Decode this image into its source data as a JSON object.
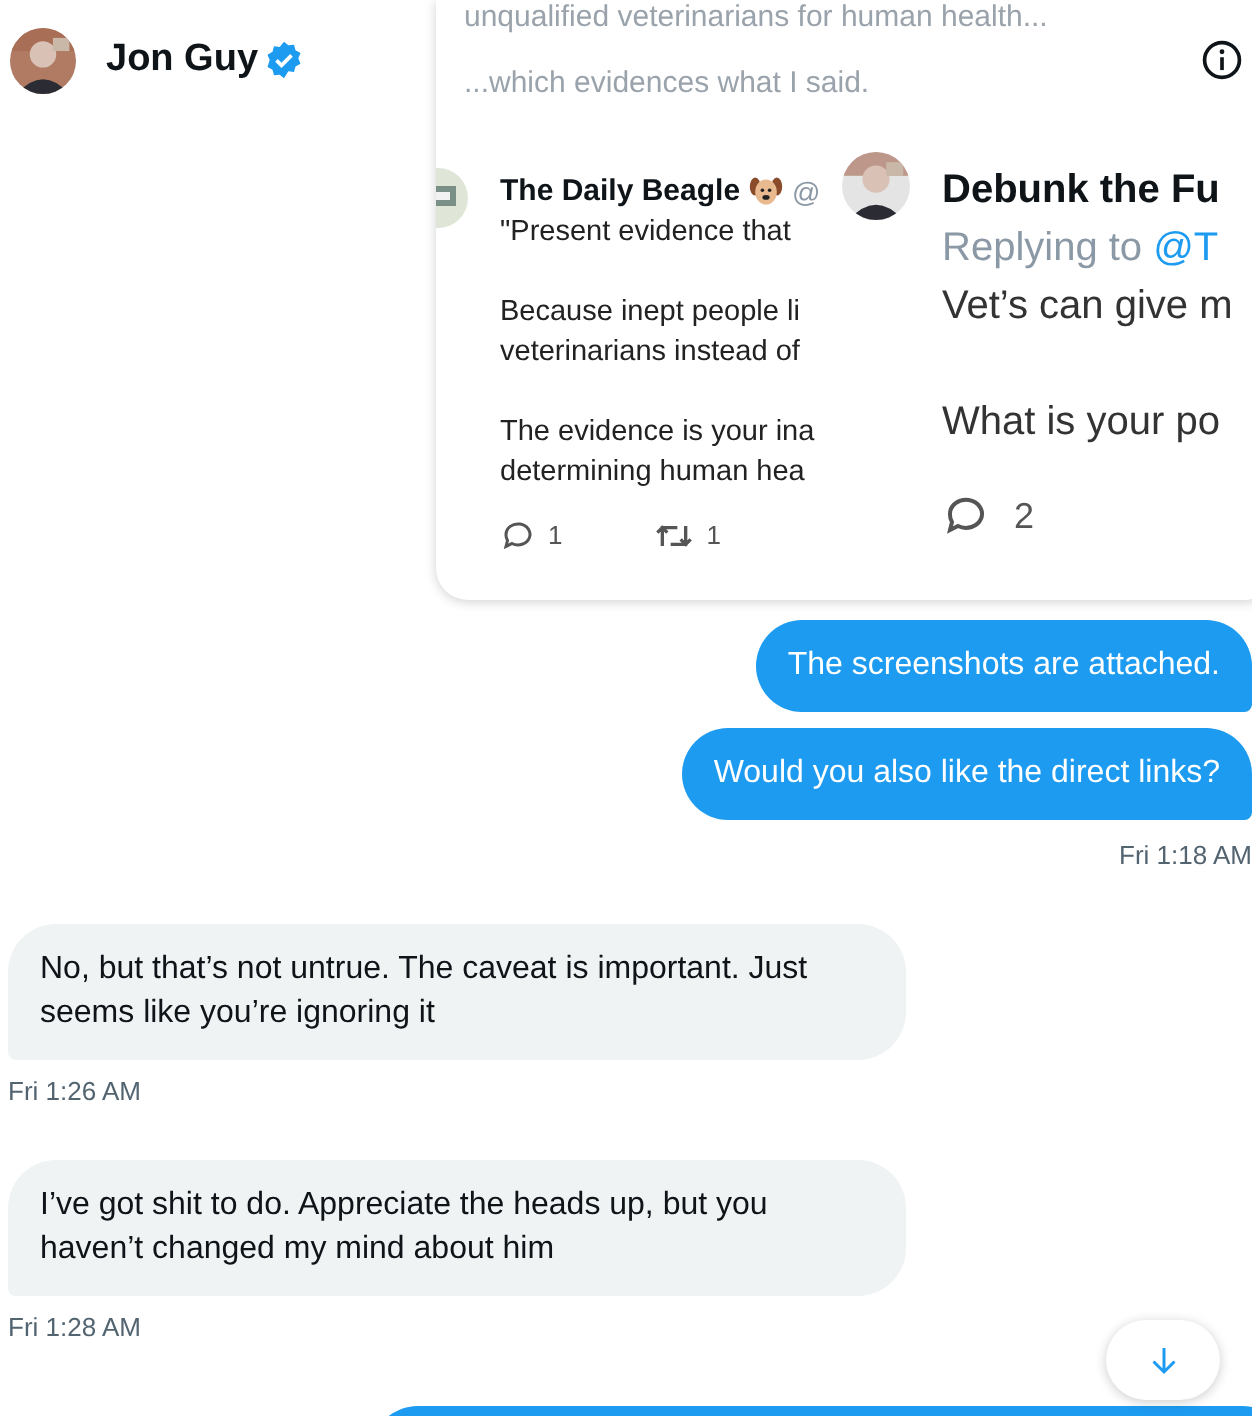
{
  "header": {
    "name": "Jon Guy",
    "verified": true
  },
  "attachment": {
    "faded_lines": [
      "unqualified veterinarians for human health...",
      "...which evidences what I said."
    ],
    "left_tweet": {
      "name": "The Daily Beagle",
      "handle": "@",
      "paragraphs": [
        [
          "\"Present evidence that"
        ],
        [
          "Because inept people li",
          "veterinarians instead of"
        ],
        [
          "The evidence is your ina",
          "determining human hea"
        ]
      ],
      "reply_count": "1",
      "retweet_count": "1"
    },
    "right_tweet": {
      "name": "Debunk the Fu",
      "replying_prefix": "Replying to",
      "replying_handle": "@T",
      "paragraphs": [
        "Vet’s can give m",
        "What is your po"
      ],
      "reply_count": "2"
    }
  },
  "messages": [
    {
      "kind": "sent",
      "text": "The screenshots are attached."
    },
    {
      "kind": "sent",
      "text": "Would you also like the direct links?"
    },
    {
      "kind": "sent_time",
      "text": "Fri 1:18 AM"
    },
    {
      "kind": "received",
      "text": "No, but that’s not untrue. The caveat is important. Just seems like you’re ignoring it"
    },
    {
      "kind": "received_time",
      "text": "Fri 1:26 AM"
    },
    {
      "kind": "received",
      "text": "I’ve got shit to do. Appreciate the heads up, but you haven’t changed my mind about him"
    },
    {
      "kind": "received_time",
      "text": "Fri 1:28 AM"
    },
    {
      "kind": "sent_partial"
    }
  ]
}
